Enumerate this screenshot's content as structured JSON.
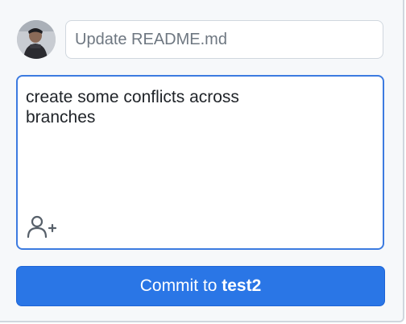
{
  "commit": {
    "summary_placeholder": "Update README.md",
    "summary_value": "",
    "description": "create some conflicts across\nbranches",
    "button_prefix": "Commit to",
    "branch": "test2"
  },
  "icons": {
    "avatar": "user-avatar",
    "coauthor": "add-person-icon"
  },
  "colors": {
    "accent": "#2a76e6",
    "focus_border": "#3c7be0",
    "panel_bg": "#f6f8fa"
  }
}
